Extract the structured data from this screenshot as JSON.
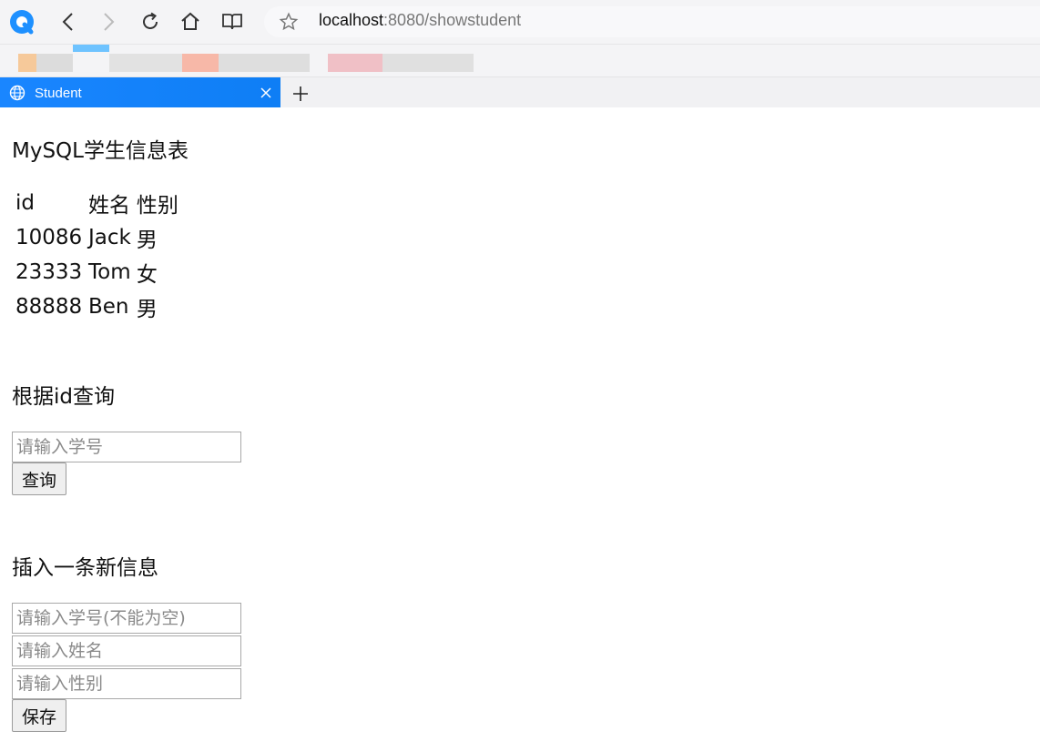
{
  "browser": {
    "url_host": "localhost",
    "url_path": ":8080/showstudent",
    "tab_title": "Student"
  },
  "page": {
    "table_heading": "MySQL学生信息表",
    "table_headers": [
      "id",
      "姓名",
      "性别"
    ],
    "rows": [
      [
        "10086",
        "Jack",
        "男"
      ],
      [
        "23333",
        "Tom",
        "女"
      ],
      [
        "88888",
        "Ben",
        "男"
      ]
    ],
    "query_heading": "根据id查询",
    "query_placeholder": "请输入学号",
    "query_button": "查询",
    "insert_heading": "插入一条新信息",
    "insert_id_placeholder": "请输入学号(不能为空)",
    "insert_name_placeholder": "请输入姓名",
    "insert_gender_placeholder": "请输入性别",
    "save_button": "保存"
  },
  "colors": {
    "tab_active": "#1a86ff",
    "chrome_bg": "#f4f4f6",
    "logo": "#1e90ff"
  }
}
